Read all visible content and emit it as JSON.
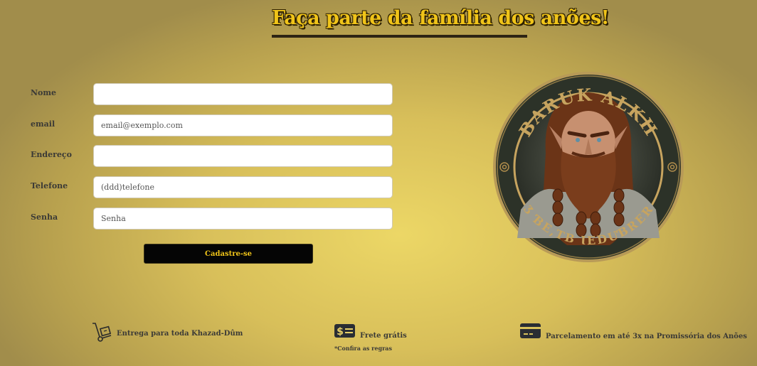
{
  "page": {
    "title": "Faça parte da família dos anões!"
  },
  "form": {
    "fields": [
      {
        "label": "Nome",
        "value": "",
        "placeholder": ""
      },
      {
        "label": "email",
        "value": "",
        "placeholder": "email@exemplo.com"
      },
      {
        "label": "Endereço",
        "value": "",
        "placeholder": ""
      },
      {
        "label": "Telefone",
        "value": "",
        "placeholder": "(ddd)telefone"
      },
      {
        "label": "Senha",
        "value": "",
        "placeholder": "Senha"
      }
    ],
    "submit_label": "Cadastre-se"
  },
  "logo": {
    "top_text": "BARUK ALKH",
    "bottom_text": "Ʒ ƁE,TB ƖEDUƁRER"
  },
  "features": {
    "delivery": {
      "icon": "hand-truck-icon",
      "text": "Entrega para toda Khazad-Dûm"
    },
    "shipping": {
      "icon": "money-bill-icon",
      "text": "Frete grátis",
      "note": "*Confira as regras"
    },
    "installments": {
      "icon": "credit-card-icon",
      "text": "Parcelamento em até 3x na Promissória dos Anões"
    }
  },
  "colors": {
    "accent": "#f0c419",
    "button_bg": "#050505",
    "text": "#3b3a36"
  }
}
